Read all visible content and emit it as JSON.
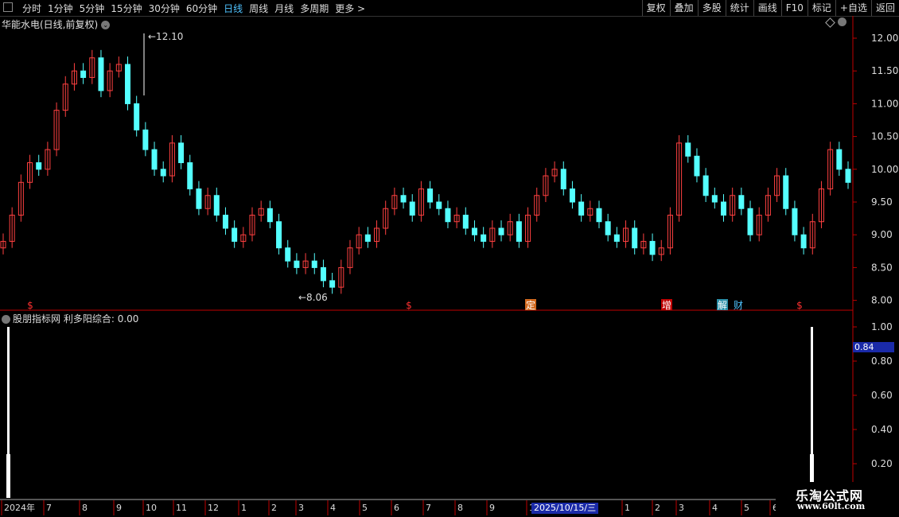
{
  "toolbar": {
    "left": [
      "分时",
      "1分钟",
      "5分钟",
      "15分钟",
      "30分钟",
      "60分钟",
      "日线",
      "周线",
      "月线",
      "多周期",
      "更多 >"
    ],
    "active": "日线",
    "right": [
      "复权",
      "叠加",
      "多股",
      "统计",
      "画线",
      "F10",
      "标记",
      "+自选",
      "返回"
    ]
  },
  "stock": {
    "title": "华能水电(日线,前复权)",
    "high_marker": "12.10",
    "low_marker": "8.06"
  },
  "price_axis": [
    "12.00",
    "11.50",
    "11.00",
    "10.50",
    "10.00",
    "9.50",
    "9.00",
    "8.50",
    "8.00"
  ],
  "events": [
    {
      "label": "$",
      "color": "#ff3030",
      "bg": "none"
    },
    {
      "label": "$",
      "color": "#ff3030",
      "bg": "none"
    },
    {
      "label": "定",
      "color": "#fff",
      "bg": "#d2691e"
    },
    {
      "label": "增",
      "color": "#fff",
      "bg": "#c00000"
    },
    {
      "label": "解",
      "color": "#fff",
      "bg": "#2b8fa8"
    },
    {
      "label": "财",
      "color": "#4fc3ff",
      "bg": "none"
    },
    {
      "label": "$",
      "color": "#ff3030",
      "bg": "none"
    }
  ],
  "indicator": {
    "name": "股朋指标网",
    "line": "利多阳综合: 0.00",
    "axis": [
      "1.00",
      "0.80",
      "0.60",
      "0.40",
      "0.20"
    ],
    "current_value": "0.84"
  },
  "time_axis": [
    "2024年",
    "7",
    "8",
    "9",
    "10",
    "11",
    "12",
    "1",
    "2",
    "3",
    "4",
    "5",
    "6",
    "7",
    "8",
    "9",
    "1",
    "1",
    "2",
    "3",
    "4",
    "5",
    "6"
  ],
  "date_badge": "2025/10/15/三",
  "watermark": {
    "line1": "乐淘公式网",
    "line2": "www.60lt.com"
  },
  "colors": {
    "up": "#ff4040",
    "down": "#54ffff",
    "axis_line": "#c00000"
  },
  "chart_data": {
    "type": "candlestick",
    "ylim": [
      7.9,
      12.2
    ],
    "close": [
      8.9,
      9.3,
      9.8,
      10.1,
      10.0,
      10.3,
      10.9,
      11.3,
      11.5,
      11.4,
      11.7,
      11.2,
      11.5,
      11.6,
      11.0,
      10.6,
      10.3,
      10.0,
      9.9,
      10.4,
      10.1,
      9.7,
      9.4,
      9.6,
      9.3,
      9.1,
      8.9,
      9.0,
      9.3,
      9.4,
      9.2,
      8.8,
      8.6,
      8.5,
      8.6,
      8.5,
      8.3,
      8.2,
      8.5,
      8.8,
      9.0,
      8.9,
      9.1,
      9.4,
      9.6,
      9.5,
      9.3,
      9.7,
      9.5,
      9.4,
      9.2,
      9.3,
      9.1,
      9.0,
      8.9,
      9.1,
      9.0,
      9.2,
      8.9,
      9.3,
      9.6,
      9.9,
      10.0,
      9.7,
      9.5,
      9.3,
      9.4,
      9.2,
      9.0,
      8.9,
      9.1,
      8.8,
      8.9,
      8.7,
      8.8,
      9.3,
      10.4,
      10.2,
      9.9,
      9.6,
      9.5,
      9.3,
      9.6,
      9.4,
      9.0,
      9.3,
      9.6,
      9.9,
      9.4,
      9.0,
      8.8,
      9.2,
      9.7,
      10.3,
      10.0,
      9.8
    ]
  }
}
